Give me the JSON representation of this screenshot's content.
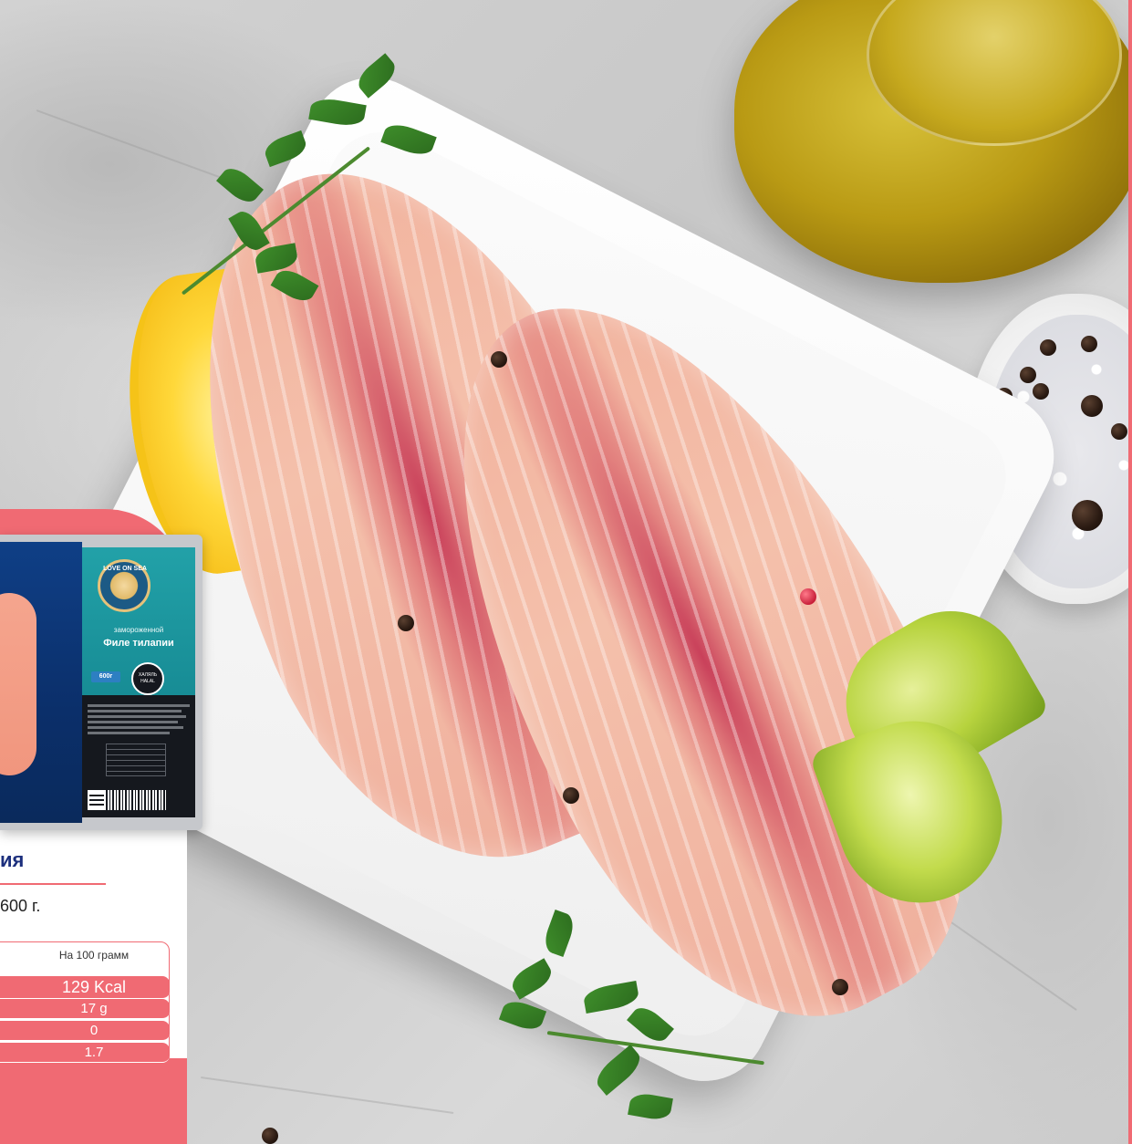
{
  "package": {
    "brand_logo_text": "LOVE ON SEA",
    "frozen_label": "замороженной",
    "product_name": "Филе тилапии",
    "weight_badge": "600г",
    "halal_mark": "ХАЛЯЛЬ HALAL"
  },
  "card": {
    "title_fragment": "ия",
    "weight_fragment": "600 г."
  },
  "nutrition": {
    "header": "На 100 грамм",
    "rows": [
      {
        "value": "129 Kcal"
      },
      {
        "value": "17 g"
      },
      {
        "value": "0"
      },
      {
        "value": "1.7"
      }
    ]
  },
  "colors": {
    "accent": "#f06a73",
    "title_blue": "#1c2f7d",
    "teal": "#22a1a8",
    "navy": "#0f3f86"
  },
  "icons": [
    "halal-badge-icon",
    "barcode-icon",
    "qr-code-icon",
    "brand-logo-icon"
  ]
}
